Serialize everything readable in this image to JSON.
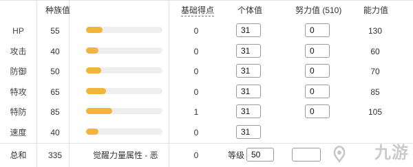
{
  "headers": {
    "base_stat": "种族值",
    "base_points": "基础得点",
    "iv": "个体值",
    "ev": "努力值 (510)",
    "stat": "能力值"
  },
  "rows": [
    {
      "label": "HP",
      "base": "55",
      "bar_fraction": 0.22,
      "ev_points": "0",
      "iv": "31",
      "ev": "0",
      "stat": "130"
    },
    {
      "label": "攻击",
      "base": "40",
      "bar_fraction": 0.16,
      "ev_points": "0",
      "iv": "31",
      "ev": "0",
      "stat": "60"
    },
    {
      "label": "防御",
      "base": "50",
      "bar_fraction": 0.2,
      "ev_points": "0",
      "iv": "31",
      "ev": "0",
      "stat": "70"
    },
    {
      "label": "特攻",
      "base": "65",
      "bar_fraction": 0.26,
      "ev_points": "0",
      "iv": "31",
      "ev": "0",
      "stat": "85"
    },
    {
      "label": "特防",
      "base": "85",
      "bar_fraction": 0.34,
      "ev_points": "1",
      "iv": "31",
      "ev": "0",
      "stat": "105"
    },
    {
      "label": "速度",
      "base": "40",
      "bar_fraction": 0.16,
      "ev_points": "0",
      "iv": "31",
      "ev": "",
      "stat": ""
    }
  ],
  "summary": {
    "label": "总和",
    "base_total": "335",
    "hidden_power": "觉醒力量属性 - 恶",
    "ev_points": "0",
    "level_label": "等级",
    "level_value": "50"
  },
  "watermark": "九游",
  "colors": {
    "bar_fill": "#f2b53c",
    "bar_track": "#eeeeee",
    "grid": "#e2e2e2"
  }
}
